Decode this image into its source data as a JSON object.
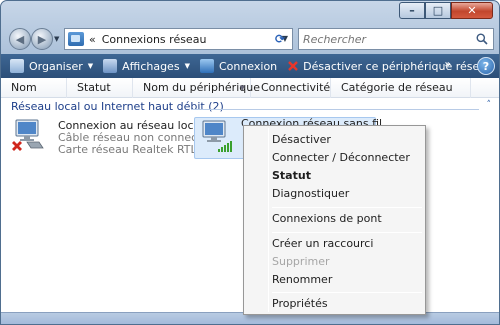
{
  "window": {
    "minimize_glyph": "–",
    "maximize_glyph": "□",
    "close_glyph": "✕"
  },
  "navigation": {
    "address_chevron": "«",
    "address_path": "Connexions réseau",
    "search_placeholder": "Rechercher"
  },
  "toolbar": {
    "organize_label": "Organiser",
    "views_label": "Affichages",
    "connect_label": "Connexion",
    "disable_device_label": "Désactiver ce périphérique réseau",
    "more_glyph": "»",
    "help_glyph": "?"
  },
  "columns": [
    "Nom",
    "Statut",
    "Nom du périphérique",
    "Connectivité",
    "Catégorie de réseau"
  ],
  "group": {
    "label": "Réseau local ou Internet haut débit (2)",
    "chevron": "˄"
  },
  "connections": [
    {
      "name": "Connexion au réseau local",
      "status": "Câble réseau non connecté",
      "device": "Carte réseau Realtek RTL816..."
    },
    {
      "name": "Connexion réseau sans fil"
    }
  ],
  "context_menu": {
    "items": [
      {
        "label": "Désactiver",
        "style": "normal"
      },
      {
        "label": "Connecter / Déconnecter",
        "style": "normal"
      },
      {
        "label": "Statut",
        "style": "bold"
      },
      {
        "label": "Diagnostiquer",
        "style": "normal"
      },
      {
        "label": "Connexions de pont",
        "style": "normal"
      },
      {
        "label": "Créer un raccourci",
        "style": "normal"
      },
      {
        "label": "Supprimer",
        "style": "disabled"
      },
      {
        "label": "Renommer",
        "style": "normal"
      },
      {
        "label": "Propriétés",
        "style": "normal"
      }
    ]
  },
  "colors": {
    "toolbar": "#2c4f78",
    "group_text": "#1e3f8a",
    "selection": "#dcebfb",
    "error_red": "#d0271c",
    "signal_green": "#3aa02e"
  }
}
